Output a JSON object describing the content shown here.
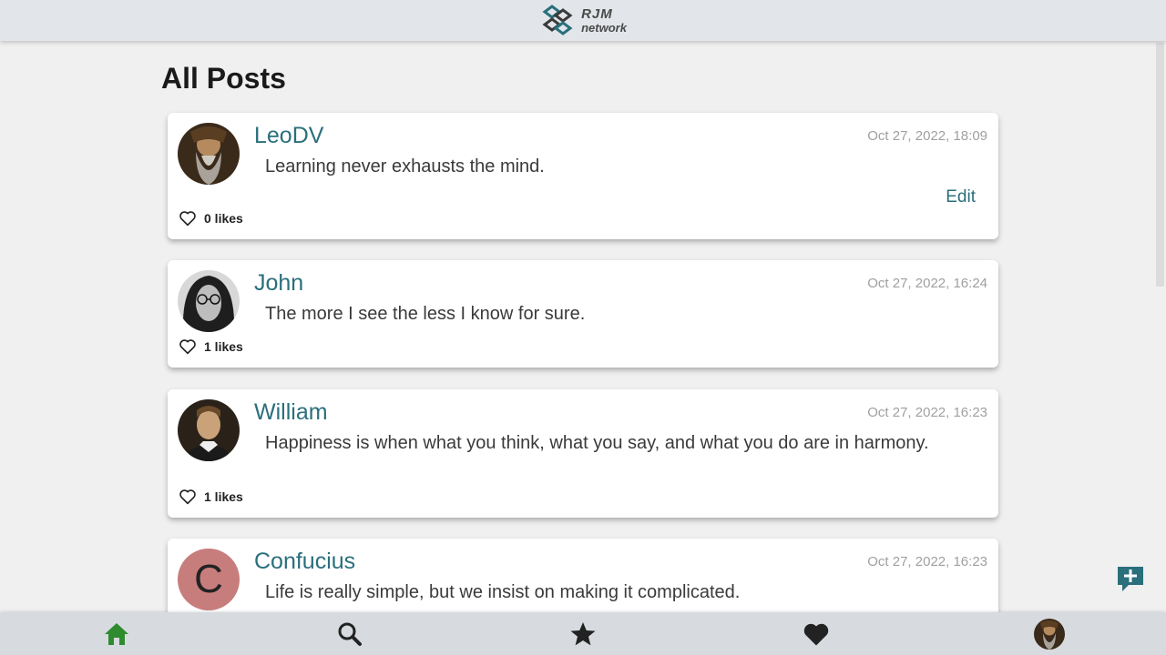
{
  "header": {
    "logo_line1": "RJM",
    "logo_line2": "network"
  },
  "page": {
    "title": "All Posts"
  },
  "posts": [
    {
      "user": "LeoDV",
      "time": "Oct 27, 2022, 18:09",
      "text": "Learning never exhausts the mind.",
      "likes": "0 likes",
      "edit": "Edit"
    },
    {
      "user": "John",
      "time": "Oct 27, 2022, 16:24",
      "text": "The more I see the less I know for sure.",
      "likes": "1 likes"
    },
    {
      "user": "William",
      "time": "Oct 27, 2022, 16:23",
      "text": "Happiness is when what you think, what you say, and what you do are in harmony.",
      "likes": "1 likes"
    },
    {
      "user": "Confucius",
      "avatar_initial": "C",
      "time": "Oct 27, 2022, 16:23",
      "text": "Life is really simple, but we insist on making it complicated."
    }
  ],
  "nav": {
    "items": [
      {
        "icon": "home-icon",
        "active": true
      },
      {
        "icon": "search-icon"
      },
      {
        "icon": "star-icon"
      },
      {
        "icon": "heart-icon"
      },
      {
        "icon": "profile-avatar"
      }
    ]
  },
  "colors": {
    "accent": "#2a6f7c",
    "active_nav": "#2e8b2e",
    "header_bg": "#e2e6ea",
    "nav_bg": "#d7dbdf"
  }
}
